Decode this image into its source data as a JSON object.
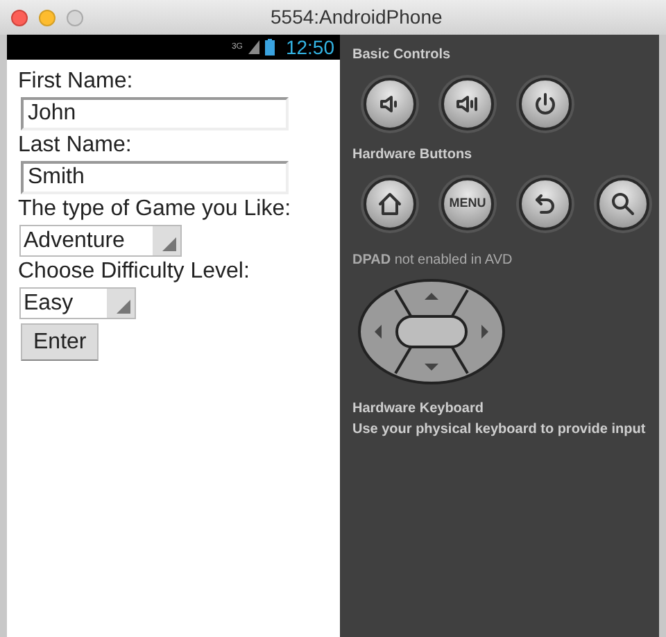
{
  "window": {
    "title": "5554:AndroidPhone"
  },
  "status_bar": {
    "network": "3G",
    "time": "12:50"
  },
  "form": [
    {
      "kind": "label",
      "text": "First Name:"
    },
    {
      "kind": "input",
      "value": "John"
    },
    {
      "kind": "label",
      "text": "Last Name:"
    },
    {
      "kind": "input",
      "value": "Smith"
    },
    {
      "kind": "label",
      "text": "The type of Game you Like:"
    },
    {
      "kind": "select",
      "value": "Adventure"
    },
    {
      "kind": "label",
      "text": "Choose Difficulty Level:"
    },
    {
      "kind": "select",
      "value": "Easy"
    },
    {
      "kind": "button",
      "text": "Enter"
    }
  ],
  "basic_controls": {
    "title": "Basic Controls"
  },
  "hardware_buttons": {
    "title": "Hardware Buttons",
    "menu_label": "MENU"
  },
  "dpad": {
    "title": "**DPAD** not enabled in AVD"
  },
  "hardware_keyboard": {
    "title": "Hardware Keyboard",
    "hint": "Use your physical keyboard to provide input"
  }
}
